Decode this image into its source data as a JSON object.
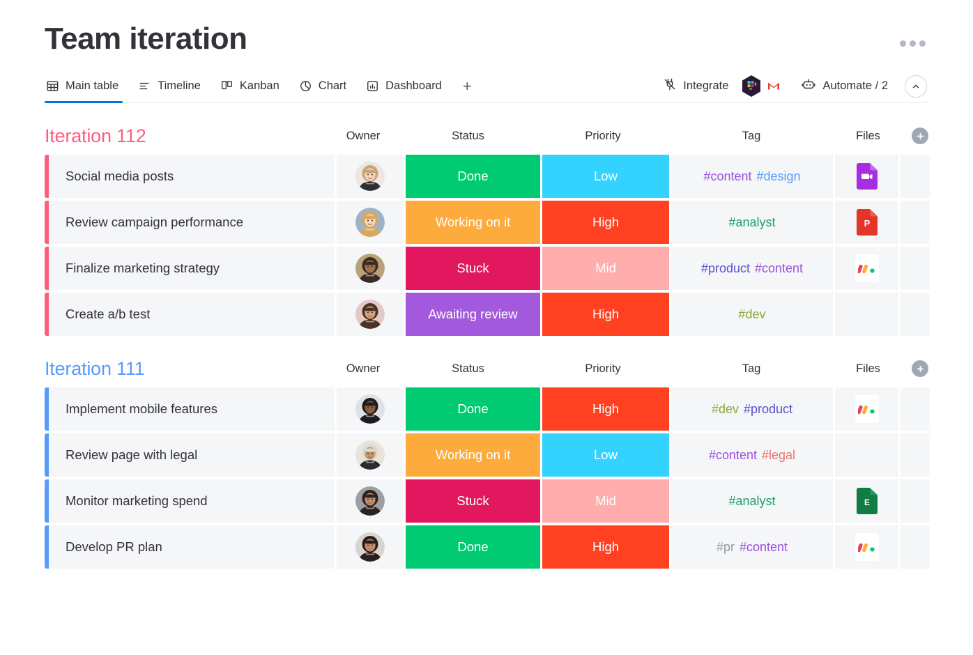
{
  "header": {
    "title": "Team iteration",
    "more_menu": "more-options"
  },
  "tabs": [
    {
      "label": "Main table",
      "icon": "table-icon",
      "active": true
    },
    {
      "label": "Timeline",
      "icon": "timeline-icon",
      "active": false
    },
    {
      "label": "Kanban",
      "icon": "kanban-icon",
      "active": false
    },
    {
      "label": "Chart",
      "icon": "chart-icon",
      "active": false
    },
    {
      "label": "Dashboard",
      "icon": "dashboard-icon",
      "active": false
    }
  ],
  "tab_add_label": "+",
  "toolbar": {
    "integrate_label": "Integrate",
    "automate_label": "Automate / 2",
    "apps": [
      "slack-icon",
      "gmail-icon"
    ]
  },
  "columns": [
    "Owner",
    "Status",
    "Priority",
    "Tag",
    "Files"
  ],
  "colors": {
    "accent": "#0073ea",
    "group_112": "#ff5f7e",
    "group_111": "#579bfc",
    "done": "#00ca72",
    "working_on_it": "#fdab3d",
    "stuck": "#e2185f",
    "awaiting_review": "#a259dc",
    "low": "#33d2ff",
    "high": "#ff4122",
    "mid": "#ffadad"
  },
  "tag_colors": {
    "#content": "#9b51e0",
    "#design": "#579bfc",
    "#analyst": "#1f9e6b",
    "#product": "#5e4fd0",
    "#dev": "#8aab3a",
    "#legal": "#f1706e",
    "#pr": "#9699a6"
  },
  "groups": [
    {
      "title": "Iteration 112",
      "color": "#ff5f7e",
      "add_column": "+",
      "rows": [
        {
          "name": "Social media posts",
          "avatar": "avatar-blonde-woman",
          "status": "Done",
          "status_color": "#00ca72",
          "priority": "Low",
          "priority_color": "#33d2ff",
          "tags": [
            "#content",
            "#design"
          ],
          "file": "video-file-icon"
        },
        {
          "name": "Review campaign performance",
          "avatar": "avatar-curly-woman",
          "status": "Working on it",
          "status_color": "#fdab3d",
          "priority": "High",
          "priority_color": "#ff4122",
          "tags": [
            "#analyst"
          ],
          "file": "powerpoint-file-icon"
        },
        {
          "name": "Finalize marketing strategy",
          "avatar": "avatar-bearded-man",
          "status": "Stuck",
          "status_color": "#e2185f",
          "priority": "Mid",
          "priority_color": "#ffadad",
          "tags": [
            "#product",
            "#content"
          ],
          "file": "monday-file-icon"
        },
        {
          "name": "Create a/b test",
          "avatar": "avatar-smiling-woman",
          "status": "Awaiting review",
          "status_color": "#a259dc",
          "priority": "High",
          "priority_color": "#ff4122",
          "tags": [
            "#dev"
          ],
          "file": ""
        }
      ]
    },
    {
      "title": "Iteration 111",
      "color": "#579bfc",
      "add_column": "+",
      "rows": [
        {
          "name": "Implement mobile features",
          "avatar": "avatar-beard-dark-man",
          "status": "Done",
          "status_color": "#00ca72",
          "priority": "High",
          "priority_color": "#ff4122",
          "tags": [
            "#dev",
            "#product"
          ],
          "file": "monday-file-icon"
        },
        {
          "name": "Review page with legal",
          "avatar": "avatar-older-man",
          "status": "Working on it",
          "status_color": "#fdab3d",
          "priority": "Low",
          "priority_color": "#33d2ff",
          "tags": [
            "#content",
            "#legal"
          ],
          "file": ""
        },
        {
          "name": "Monitor marketing spend",
          "avatar": "avatar-dark-hair-woman",
          "status": "Stuck",
          "status_color": "#e2185f",
          "priority": "Mid",
          "priority_color": "#ffadad",
          "tags": [
            "#analyst"
          ],
          "file": "excel-file-icon"
        },
        {
          "name": "Develop PR plan",
          "avatar": "avatar-long-hair-woman",
          "status": "Done",
          "status_color": "#00ca72",
          "priority": "High",
          "priority_color": "#ff4122",
          "tags": [
            "#pr",
            "#content"
          ],
          "file": "monday-file-icon"
        }
      ]
    }
  ]
}
